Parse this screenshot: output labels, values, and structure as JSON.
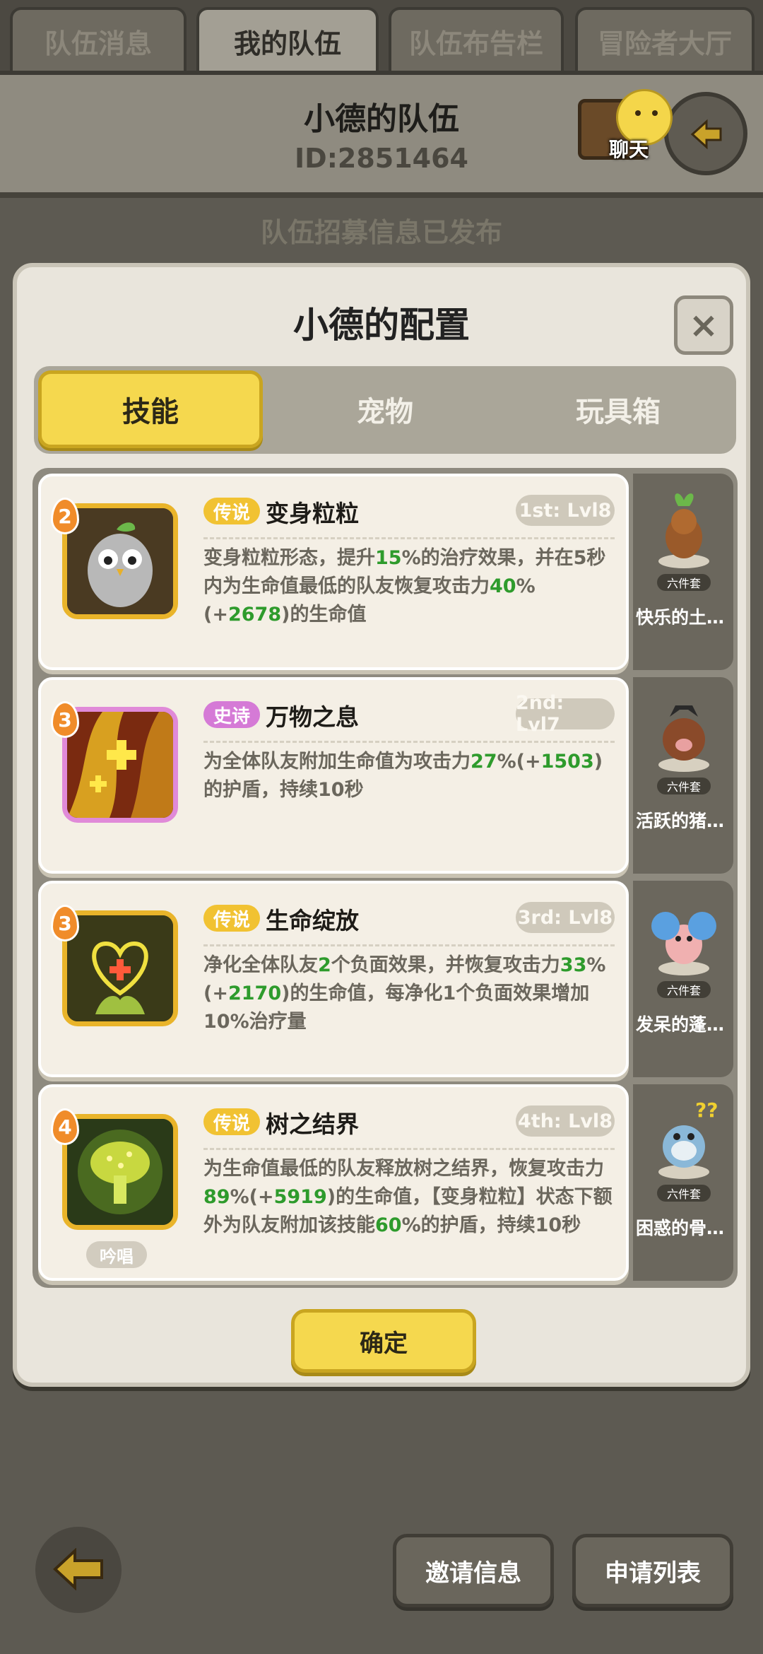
{
  "top_tabs": [
    {
      "label": "队伍消息"
    },
    {
      "label": "我的队伍"
    },
    {
      "label": "队伍布告栏"
    },
    {
      "label": "冒险者大厅"
    }
  ],
  "header": {
    "team_name": "小德的队伍",
    "team_id": "ID:2851464",
    "chat_label": "聊天"
  },
  "recruit_status": "队伍招募信息已发布",
  "modal": {
    "title": "小德的配置",
    "close_symbol": "×",
    "tabs": [
      {
        "label": "技能"
      },
      {
        "label": "宠物"
      },
      {
        "label": "玩具箱"
      }
    ],
    "confirm_label": "确定"
  },
  "skills": [
    {
      "level_badge": "2",
      "rarity": "传说",
      "name": "变身粒粒",
      "slot": "1st: Lvl8",
      "desc": [
        "变身粒粒形态，提升",
        "15",
        "%的治疗效果，并在5秒内为生命值最低的队友恢复攻击力",
        "40",
        "%(+",
        "2678",
        ")的生命值"
      ],
      "pet_name": "快乐的土…",
      "pet_set": "六件套"
    },
    {
      "level_badge": "3",
      "rarity": "史诗",
      "name": "万物之息",
      "slot": "2nd: Lvl7",
      "desc": [
        "为全体队友附加生命值为攻击力",
        "27",
        "%(+",
        "1503",
        ")的护盾，持续10秒"
      ],
      "pet_name": "活跃的猪…",
      "pet_set": "六件套"
    },
    {
      "level_badge": "3",
      "rarity": "传说",
      "name": "生命绽放",
      "slot": "3rd: Lvl8",
      "desc": [
        "净化全体队友",
        "2",
        "个负面效果，并恢复攻击力",
        "33",
        "%(+",
        "2170",
        ")的生命值，每净化1个负面效果增加10%治疗量"
      ],
      "pet_name": "发呆的蓬…",
      "pet_set": "六件套"
    },
    {
      "level_badge": "4",
      "rarity": "传说",
      "name": "树之结界",
      "slot": "4th: Lvl8",
      "desc": [
        "为生命值最低的队友释放树之结界，恢复攻击力",
        "89",
        "%(+",
        "5919",
        ")的生命值，【变身粒粒】状态下额外为队友附加该技能",
        "60",
        "%的护盾，持续10秒"
      ],
      "chant": "吟唱",
      "pet_name": "困惑的骨…",
      "pet_set": "六件套"
    }
  ],
  "bottom": {
    "invite_label": "邀请信息",
    "apply_label": "申请列表"
  },
  "colors": {
    "accent_yellow": "#f5d84e",
    "legend": "#f1c232",
    "epic": "#d57ad6",
    "highlight_green": "#2e9b2c"
  }
}
